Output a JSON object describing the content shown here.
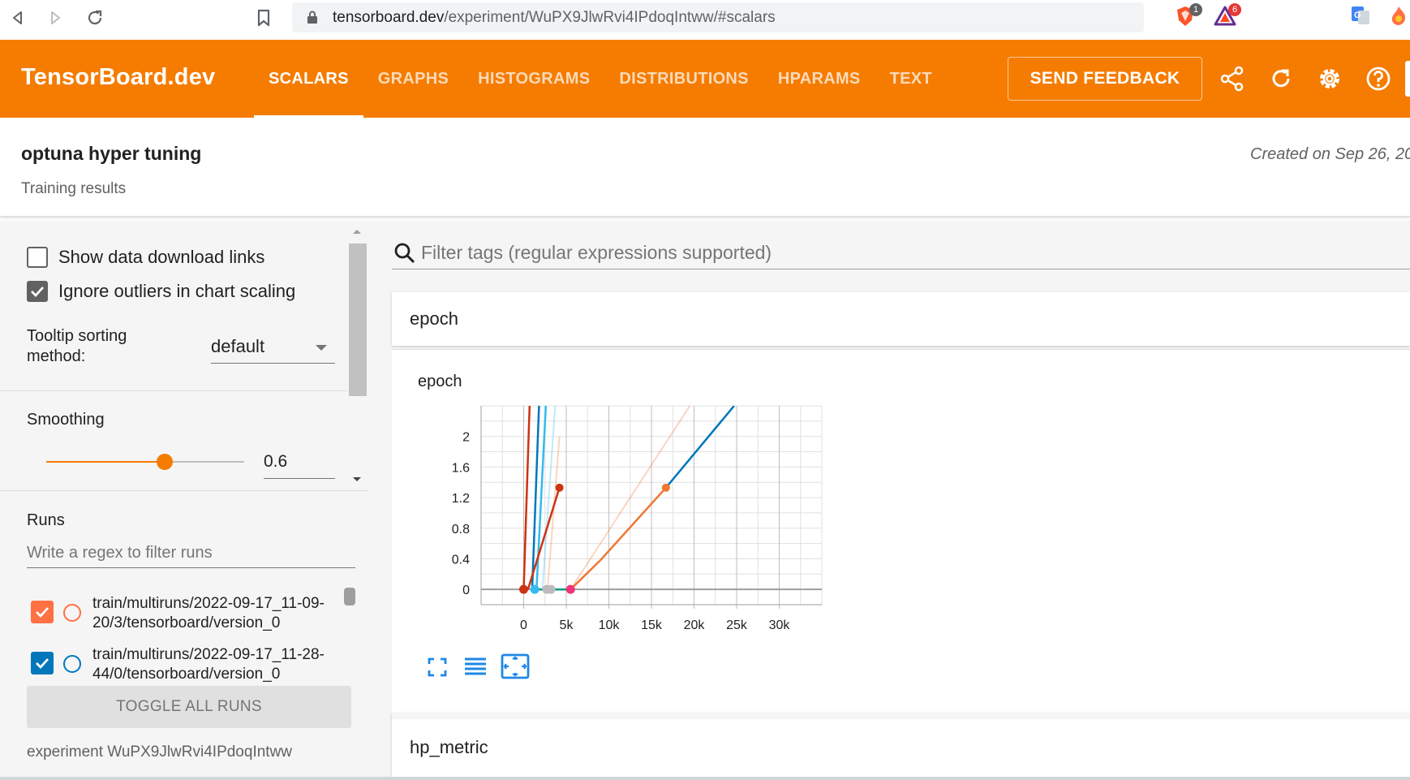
{
  "browser": {
    "url_host": "tensorboard.dev",
    "url_path": "/experiment/WuPX9JlwRvi4IPdoqIntww/#scalars",
    "ext_badges": [
      "1",
      "6"
    ]
  },
  "header": {
    "brand": "TensorBoard.dev",
    "tabs": [
      {
        "label": "SCALARS",
        "active": true
      },
      {
        "label": "GRAPHS"
      },
      {
        "label": "HISTOGRAMS"
      },
      {
        "label": "DISTRIBUTIONS"
      },
      {
        "label": "HPARAMS"
      },
      {
        "label": "TEXT"
      }
    ],
    "feedback_label": "SEND FEEDBACK"
  },
  "experiment": {
    "title": "optuna hyper tuning",
    "description": "Training results",
    "created": "Created on Sep 26, 20",
    "id_text": "experiment WuPX9JlwRvi4IPdoqIntww"
  },
  "sidebar": {
    "show_download_label": "Show data download links",
    "show_download_checked": false,
    "ignore_outliers_label": "Ignore outliers in chart scaling",
    "ignore_outliers_checked": true,
    "tooltip_sort_label": "Tooltip sorting method:",
    "tooltip_sort_value": "default",
    "smoothing_label": "Smoothing",
    "smoothing_value": "0.6",
    "smoothing_fraction": 0.6,
    "runs_label": "Runs",
    "runs_filter_placeholder": "Write a regex to filter runs",
    "runs": [
      {
        "name": "train/multiruns/2022-09-17_11-09-20/3/tensorboard/version_0",
        "color": "#ff7043",
        "checked": true
      },
      {
        "name": "train/multiruns/2022-09-17_11-28-44/0/tensorboard/version_0",
        "color": "#0077bb",
        "checked": true
      }
    ],
    "toggle_all_label": "TOGGLE ALL RUNS"
  },
  "main": {
    "filter_placeholder": "Filter tags (regular expressions supported)",
    "sections": [
      {
        "header": "epoch"
      },
      {
        "header": "hp_metric"
      }
    ]
  },
  "chart_data": {
    "type": "line",
    "title": "epoch",
    "xlim": [
      -5000,
      35000
    ],
    "ylim": [
      -0.2,
      2.4
    ],
    "x_ticks": [
      0,
      5000,
      10000,
      15000,
      20000,
      25000,
      30000
    ],
    "x_tick_labels": [
      "0",
      "5k",
      "10k",
      "15k",
      "20k",
      "25k",
      "30k"
    ],
    "y_ticks": [
      0,
      0.4,
      0.8,
      1.2,
      1.6,
      2
    ],
    "y_tick_labels": [
      "0",
      "0.4",
      "0.8",
      "1.2",
      "1.6",
      "2"
    ],
    "grid": true,
    "series": [
      {
        "color": "#cc3311",
        "points": [
          [
            0,
            0
          ],
          [
            700,
            2.4
          ]
        ]
      },
      {
        "color": "#0077bb",
        "points": [
          [
            1000,
            0
          ],
          [
            1800,
            2.4
          ]
        ]
      },
      {
        "color": "#33bbee",
        "points": [
          [
            1500,
            0
          ],
          [
            2600,
            2.4
          ]
        ]
      },
      {
        "color": "#33bbee",
        "points": [
          [
            2200,
            0
          ],
          [
            3700,
            2.4
          ]
        ],
        "faded": true
      },
      {
        "color": "#ee7733",
        "points": [
          [
            2800,
            0
          ],
          [
            4200,
            2.0
          ]
        ],
        "faded": true
      },
      {
        "color": "#cc3311",
        "points": [
          [
            500,
            0
          ],
          [
            4200,
            1.33
          ]
        ],
        "end_marker": true
      },
      {
        "color": "#009988",
        "points": [
          [
            1200,
            0
          ],
          [
            5500,
            0
          ]
        ]
      },
      {
        "color": "#0077bb",
        "points": [
          [
            16700,
            1.33
          ],
          [
            24700,
            2.4
          ]
        ]
      },
      {
        "color": "#ee7733",
        "points": [
          [
            5500,
            0
          ],
          [
            9000,
            0.38
          ],
          [
            16700,
            1.33
          ]
        ],
        "end_marker": true
      },
      {
        "color": "#ee7733",
        "points": [
          [
            5500,
            0
          ],
          [
            19500,
            2.4
          ]
        ],
        "faded": true
      }
    ],
    "markers": [
      {
        "x": 0,
        "y": 0,
        "color": "#cc3311"
      },
      {
        "x": 1300,
        "y": 0,
        "color": "#33bbee"
      },
      {
        "x": 2700,
        "y": 0,
        "color": "#bbbbbb"
      },
      {
        "x": 3200,
        "y": 0,
        "color": "#bbbbbb"
      },
      {
        "x": 5500,
        "y": 0,
        "color": "#ee3377"
      }
    ]
  },
  "colors": {
    "orange": "#f57c00",
    "run_checked_1": "#ff7043",
    "run_checked_2": "#0077bb"
  }
}
